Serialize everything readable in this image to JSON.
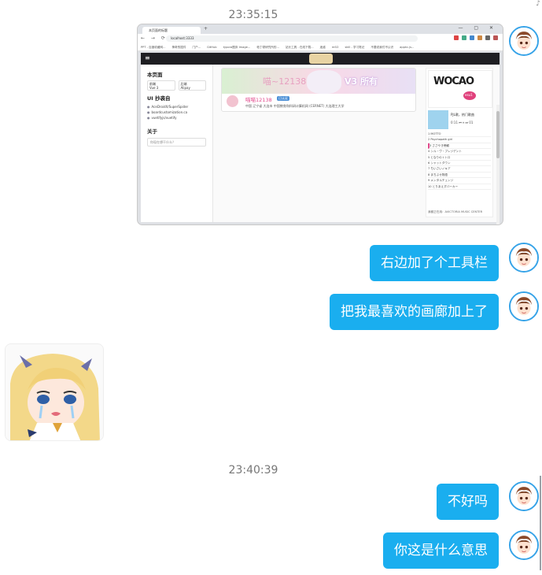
{
  "corner_glyph": "♪",
  "timestamps": [
    "23:35:15",
    "23:40:39"
  ],
  "screenshot": {
    "tab_title": "本页面的标题",
    "url": "localhost:3333",
    "window_controls": "— ▢ ✕",
    "nav_glyphs": "← → ⟳",
    "bookmarks": [
      "PPT - 百度收藏网...",
      "神奇的插件",
      "门户...",
      "GitHub",
      "typora图床 Image...",
      "帕丁顿研究所的...",
      "站长工具 - 在线下载...",
      "迷惑",
      "mSO",
      "skill - 学习笔记",
      "不要说我们不认识",
      "appkc.js..."
    ],
    "site_menu_icon": "≡",
    "sidebar": {
      "heading_page": "本页面",
      "chip_vue": "前端\nVue 3",
      "chip_alipay": "后端\nAlipay",
      "heading_ui": "UI 抄袭自",
      "items": [
        "AceDroidX/SuperSpider",
        "boardcustomization.ca",
        "vuetifyjs/vuetify"
      ],
      "heading_about": "关于",
      "input_placeholder": "你现在想干什么？"
    },
    "card": {
      "banner_left": "喵~12138",
      "banner_right": "V3 所有",
      "name": "喵喵12138",
      "badge": "已认证",
      "desc": "中国 辽宁省 大连市 中国教育和科研计算机网 (CERNET) 大连理工大学"
    },
    "right_panel": {
      "wocao_text": "WOCAO",
      "wocao_sub": "esu1",
      "player_title": "PJL歌，热门歌曲",
      "player_ctrls": "0:11 ⏮ ⏸ ⏭ 01",
      "playlist": [
        "1 MOTTO",
        "2 Psychopath girl",
        "3 ささやき傍観",
        "4 シル・ヴ・プレジデント",
        "5 となりのトトロ",
        "6 シャットダウン",
        "7 ちいさいノキア",
        "8 まちぶせ物語",
        "9 メンタルチェンジ",
        "10 とりあえずパーカー"
      ],
      "player_foot": "我都正在用：AVICTORIA MUSIC CENTER"
    }
  },
  "messages": [
    {
      "sender": "me",
      "text": "右边加了个工具栏"
    },
    {
      "sender": "me",
      "text": "把我最喜欢的画廊加上了"
    },
    {
      "sender": "me",
      "text": "不好吗"
    },
    {
      "sender": "me",
      "text": "你这是什么意思"
    }
  ],
  "colors": {
    "bubble": "#1aaeef",
    "avatar_ring": "#36a3e8"
  },
  "icons": {
    "avatar": "anime-boy-avatar",
    "sticker": "anime-girl-crying-sticker"
  }
}
